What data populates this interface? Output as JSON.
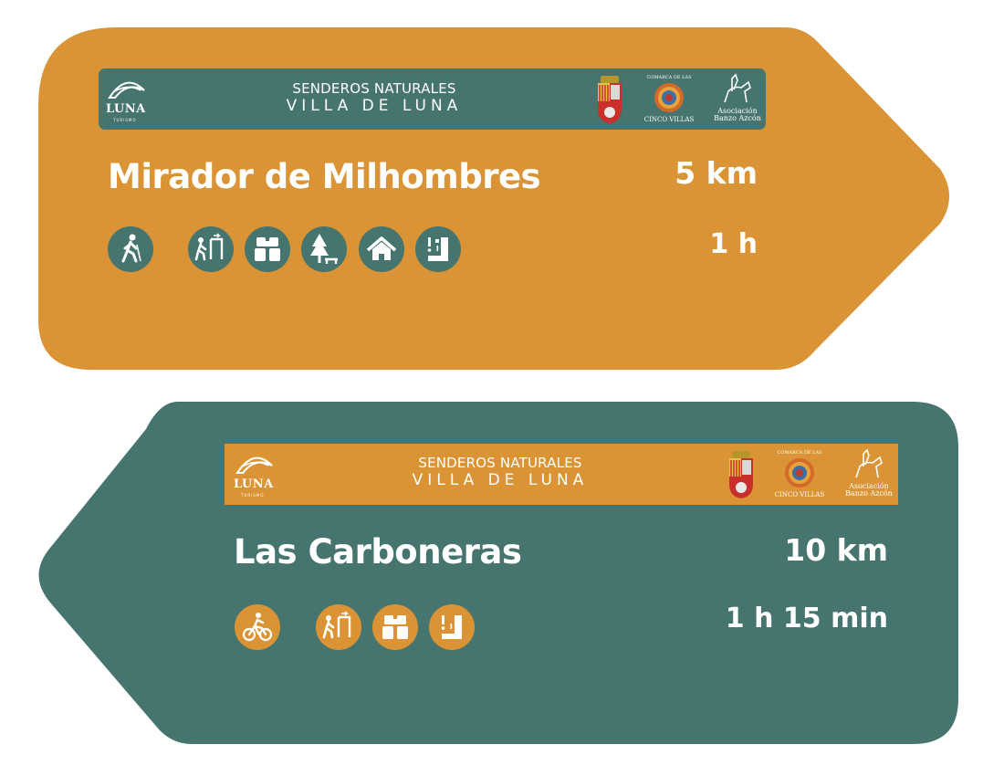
{
  "colors": {
    "orange": "#DA9436",
    "teal": "#46746E",
    "white": "#FFFFFF"
  },
  "signs": [
    {
      "direction": "right",
      "color": "orange",
      "banner": {
        "brand": "LUNA",
        "brand_sub": "TURISMO",
        "line1": "SENDEROS NATURALES",
        "line2": "VILLA DE LUNA",
        "partner": "Asociación Banzo Azcón",
        "region_top": "COMARCA DE LAS",
        "region_bottom": "CINCO VILLAS"
      },
      "title": "Mirador de Milhombres",
      "distance": "5 km",
      "duration": "1 h",
      "icons": [
        "hiker-icon",
        "viewpoint-sign-icon",
        "binoculars-icon",
        "picnic-area-icon",
        "shelter-house-icon",
        "water-fountain-icon"
      ]
    },
    {
      "direction": "left",
      "color": "teal",
      "banner": {
        "brand": "LUNA",
        "brand_sub": "TURISMO",
        "line1": "SENDEROS NATURALES",
        "line2": "VILLA DE LUNA",
        "partner": "Asociación Banzo Azcón",
        "region_top": "COMARCA DE LAS",
        "region_bottom": "CINCO VILLAS"
      },
      "title": "Las Carboneras",
      "distance": "10 km",
      "duration": "1 h 15 min",
      "icons": [
        "cyclist-icon",
        "viewpoint-sign-icon",
        "binoculars-icon",
        "water-fountain-icon"
      ]
    }
  ]
}
